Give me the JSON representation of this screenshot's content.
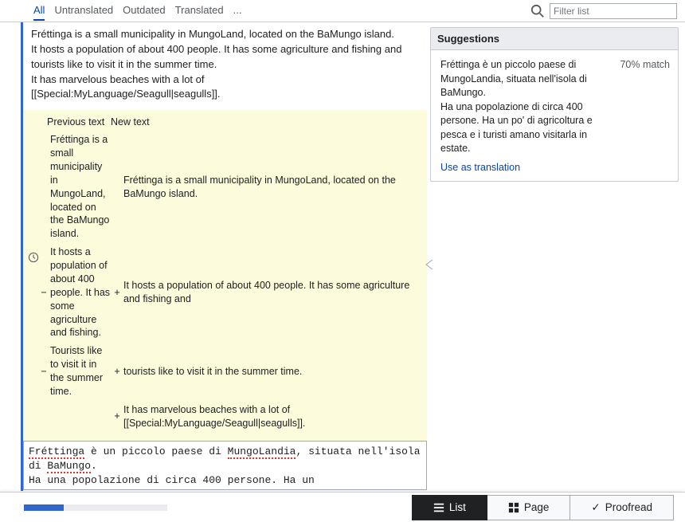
{
  "tabs": {
    "all": "All",
    "untranslated": "Untranslated",
    "outdated": "Outdated",
    "translated": "Translated",
    "more": "..."
  },
  "filter_placeholder": "Filter list",
  "source": {
    "l1": "Fréttinga is a small municipality in MungoLand, located on the BaMungo island.",
    "l2": "It hosts a population of about 400 people. It has some agriculture and fishing and",
    "l3": "tourists like to visit it in the summer time.",
    "l4": "It has marvelous beaches with a lot of",
    "l5": "[[Special:MyLanguage/Seagull|seagulls]]."
  },
  "diff": {
    "prev_label": "Previous text",
    "new_label": "New text",
    "r1_old": "Fréttinga is a small municipality in MungoLand, located on the BaMungo island.",
    "r1_new": "Fréttinga is a small municipality in MungoLand, located on the BaMungo island.",
    "r2_old": "It hosts a population of about 400 people. It has some agriculture and fishing.",
    "r2_new": "It hosts a population of about 400 people. It has some agriculture and fishing and",
    "r3_old": "Tourists like to visit it in the summer time.",
    "r3_new": "tourists like to visit it in the summer time.",
    "r4_new": "It has marvelous beaches with a lot of [[Special:MyLanguage/Seagull|seagulls]]."
  },
  "translation": {
    "w1": "Fréttinga",
    "t1": " è un piccolo paese di ",
    "w2": "MungoLandia",
    "t2": ", situata nell'isola di ",
    "w3": "BaMungo",
    "t3": ".",
    "line2": "Ha una popolazione di circa 400 persone. Ha un"
  },
  "suggestions": {
    "header": "Suggestions",
    "match": "70% match",
    "body": "Fréttinga è un piccolo paese di MungoLandia, situata nell'isola di BaMungo.\nHa una popolazione di circa 400 persone. Ha un po' di agricoltura e pesca e i turisti amano visitarla in estate.",
    "use": "Use as translation"
  },
  "footer": {
    "progress_pct": 28,
    "list": "List",
    "page": "Page",
    "proofread": "Proofread"
  }
}
